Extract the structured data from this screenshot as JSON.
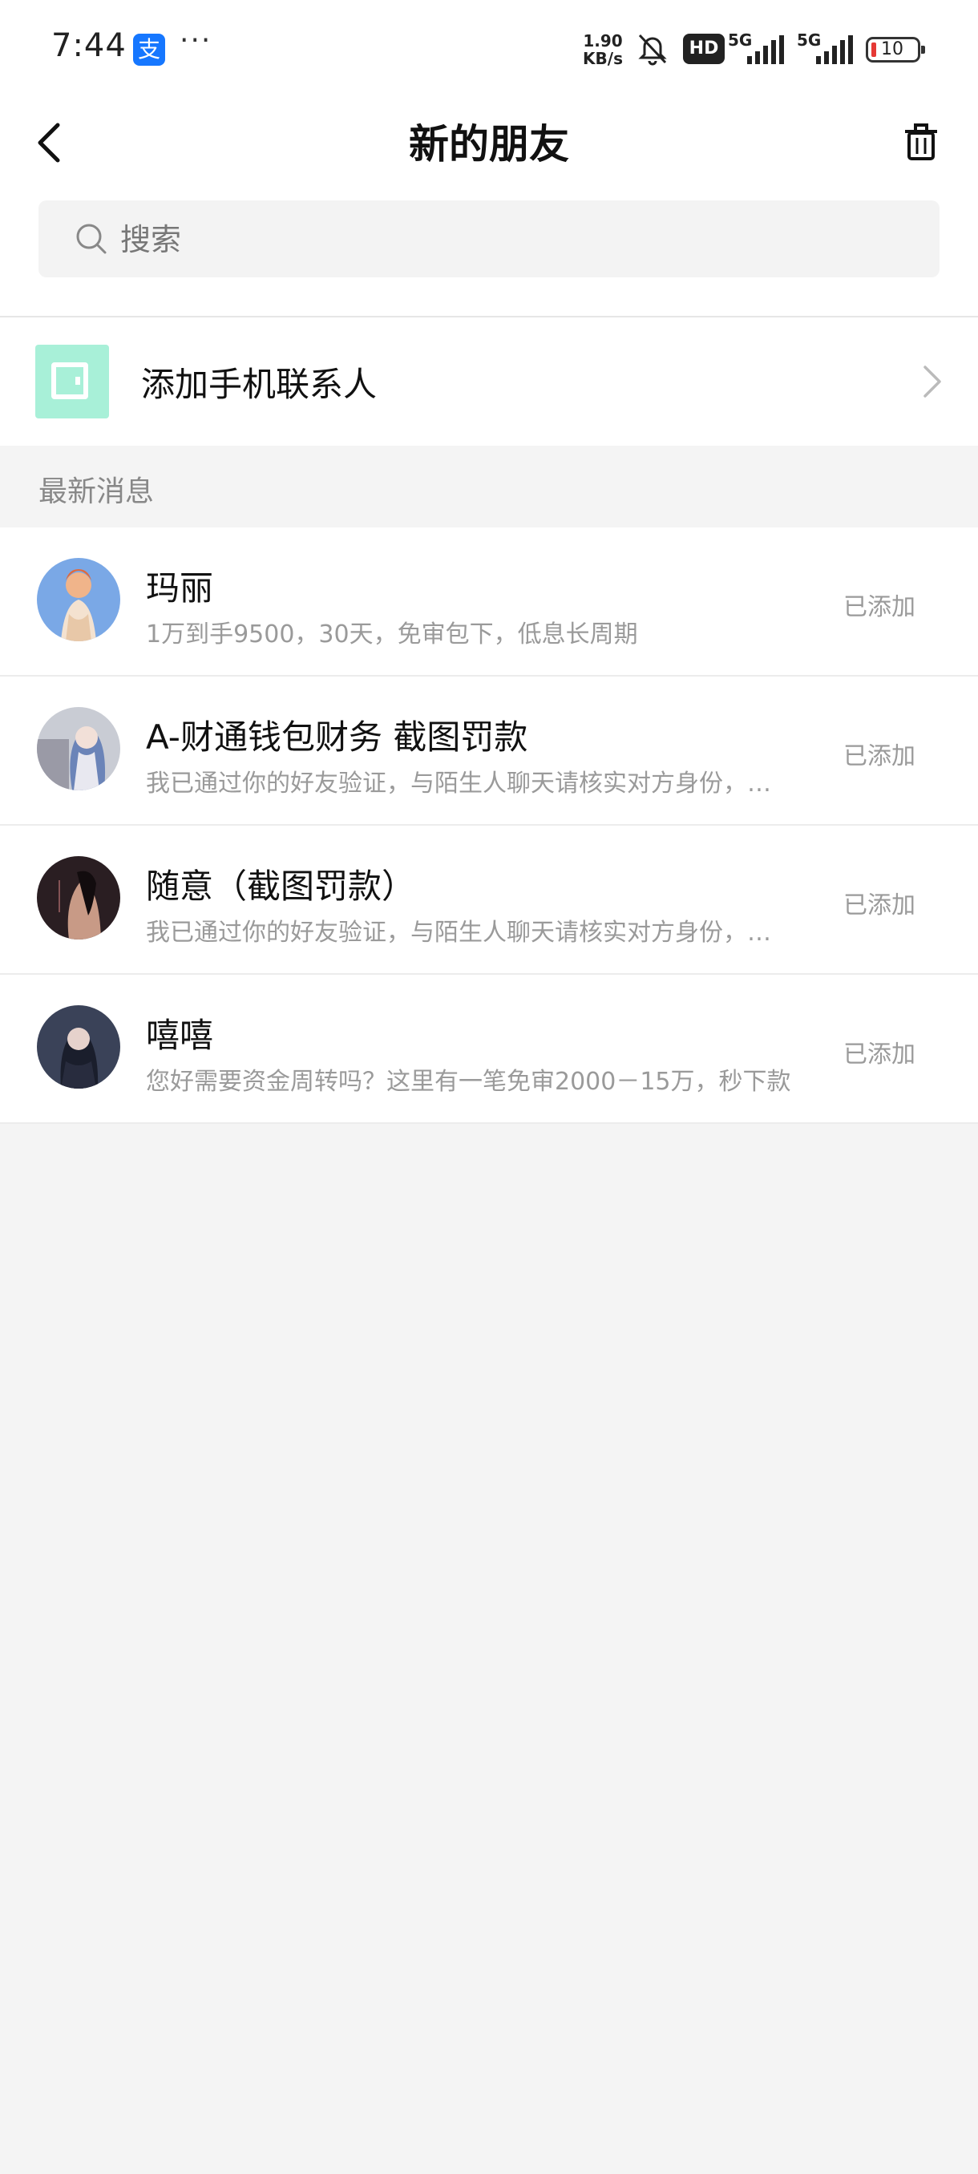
{
  "status_bar": {
    "time": "7:44",
    "alipay_glyph": "支",
    "more": "···",
    "net_speed_value": "1.90",
    "net_speed_unit": "KB/s",
    "hd": "HD",
    "sim1": "5G",
    "sim2": "5G",
    "battery": "10"
  },
  "header": {
    "title": "新的朋友"
  },
  "search": {
    "placeholder": "搜索"
  },
  "add_contacts": {
    "label": "添加手机联系人"
  },
  "section": {
    "title": "最新消息"
  },
  "requests": [
    {
      "name": "玛丽",
      "message": "1万到手9500，30天，免审包下，低息长周期",
      "status": "已添加"
    },
    {
      "name": "A-财通钱包财务  截图罚款",
      "message": "我已通过你的好友验证，与陌生人聊天请核实对方身份，谨...",
      "status": "已添加"
    },
    {
      "name": "随意（截图罚款）",
      "message": "我已通过你的好友验证，与陌生人聊天请核实对方身份，谨...",
      "status": "已添加"
    },
    {
      "name": "嘻嘻",
      "message": "您好需要资金周转吗？这里有一笔免审2000－15万，秒下款",
      "status": "已添加"
    }
  ],
  "colors": {
    "accent_contact_icon": "#a8f0d8",
    "alipay_blue": "#1677ff",
    "battery_low": "#e53935"
  }
}
